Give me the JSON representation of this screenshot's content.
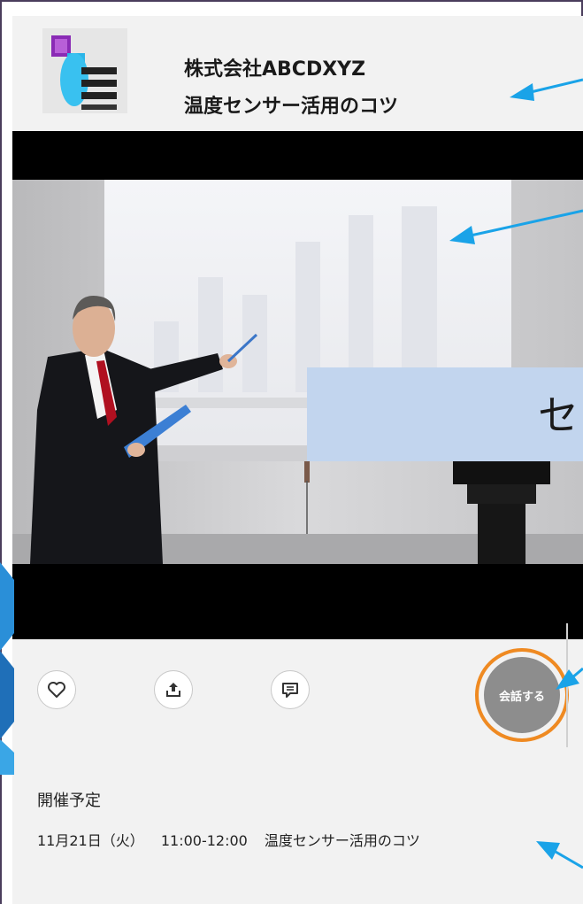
{
  "header": {
    "company": "株式会社ABCDXYZ",
    "title": "温度センサー活用のコツ",
    "logo_icon": "document-list-icon"
  },
  "video": {
    "overlay_text": "セ",
    "scene_icon": "presenter-scene-image"
  },
  "actions": {
    "like_icon": "heart-icon",
    "share_icon": "upload-icon",
    "comment_icon": "chat-icon",
    "talk_label": "会話する"
  },
  "schedule": {
    "label": "開催予定",
    "date": "11月21日（火）",
    "time": "11:00-12:00",
    "event_title": "温度センサー活用のコツ"
  },
  "colors": {
    "accent_arrow": "#1aa3e8",
    "talk_ring": "#ef8a22",
    "panel_bg": "#f2f2f2"
  }
}
